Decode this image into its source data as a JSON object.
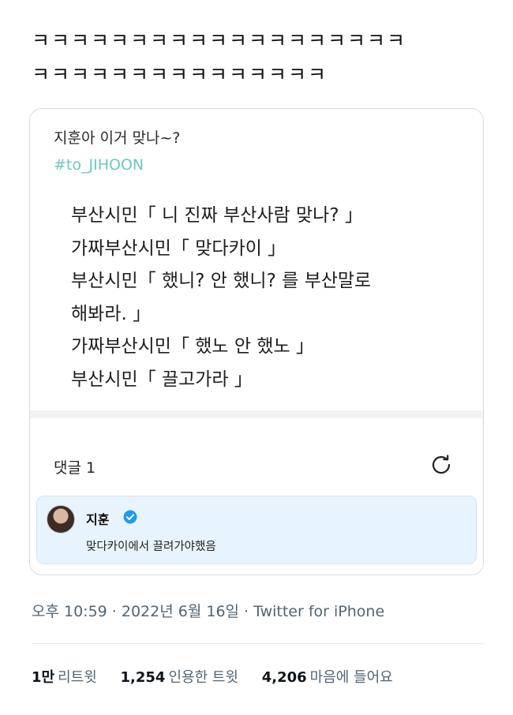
{
  "tweet": {
    "text_lines": [
      "ㅋㅋㅋㅋㅋㅋㅋㅋㅋㅋㅋㅋㅋㅋㅋㅋㅋㅋㅋ",
      "ㅋㅋㅋㅋㅋㅋㅋㅋㅋㅋㅋㅋㅋㅋㅋ"
    ]
  },
  "card": {
    "question": "지훈아 이거 맞나~?",
    "hashtag": "#to_JIHOON",
    "body_lines": [
      "부산시민「 니 진짜 부산사람 맞나? 」",
      "가짜부산시민「 맞다카이 」",
      "부산시민「 했니? 안 했니? 를 부산말로",
      "해봐라. 」",
      "가짜부산시민「 했노 안 했노 」",
      "부산시민「 끌고가라 」"
    ],
    "comments_label": "댓글 1",
    "reply": {
      "name": "지훈",
      "text": "맞다카이에서 끌려가야했음"
    }
  },
  "meta": {
    "line": "오후 10:59 · 2022년 6월 16일 · Twitter for iPhone"
  },
  "stats": {
    "retweets_count": "1만",
    "retweets_label": "리트윗",
    "quotes_count": "1,254",
    "quotes_label": "인용한 트윗",
    "likes_count": "4,206",
    "likes_label": "마음에 들어요"
  },
  "colors": {
    "hashtag": "#6cc9bd",
    "reply_bg": "#e8f4fd",
    "verified": "#1d9bf0",
    "meta_text": "#536471"
  },
  "icons": [
    "refresh-icon",
    "verified-icon"
  ]
}
